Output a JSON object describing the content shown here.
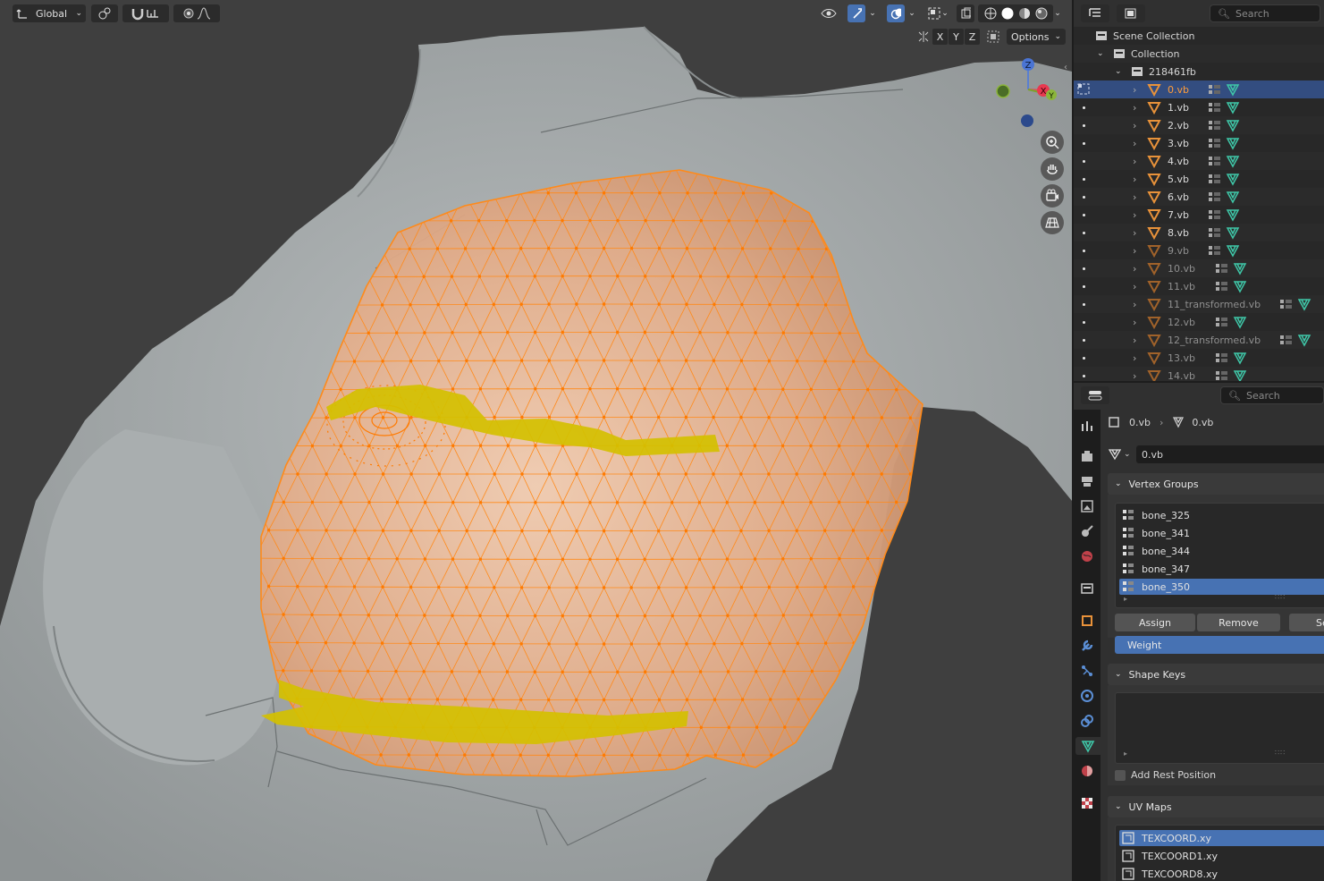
{
  "viewport": {
    "orientation": "Global",
    "options_label": "Options",
    "axes": [
      "X",
      "Y",
      "Z"
    ],
    "gizmo": {
      "z": "Z",
      "x": "X",
      "y": "Y"
    }
  },
  "outliner": {
    "search_placeholder": "Search",
    "scene_collection": "Scene Collection",
    "collection": "Collection",
    "group": "218461fb",
    "items": [
      {
        "label": "0.vb"
      },
      {
        "label": "1.vb"
      },
      {
        "label": "2.vb"
      },
      {
        "label": "3.vb"
      },
      {
        "label": "4.vb"
      },
      {
        "label": "5.vb"
      },
      {
        "label": "6.vb"
      },
      {
        "label": "7.vb"
      },
      {
        "label": "8.vb"
      },
      {
        "label": "9.vb"
      },
      {
        "label": "10.vb"
      },
      {
        "label": "11.vb"
      },
      {
        "label": "11_transformed.vb"
      },
      {
        "label": "12.vb"
      },
      {
        "label": "12_transformed.vb"
      },
      {
        "label": "13.vb"
      },
      {
        "label": "14.vb"
      }
    ]
  },
  "properties": {
    "search_placeholder": "Search",
    "breadcrumb_object": "0.vb",
    "breadcrumb_mesh": "0.vb",
    "mesh_name": "0.vb",
    "vertex_groups": {
      "title": "Vertex Groups",
      "items": [
        "bone_325",
        "bone_341",
        "bone_344",
        "bone_347",
        "bone_350"
      ],
      "assign": "Assign",
      "remove": "Remove",
      "select": "Se",
      "weight": "Weight"
    },
    "shape_keys": {
      "title": "Shape Keys",
      "add_rest_position": "Add Rest Position"
    },
    "uv_maps": {
      "title": "UV Maps",
      "items": [
        "TEXCOORD.xy",
        "TEXCOORD1.xy",
        "TEXCOORD8.xy"
      ]
    }
  },
  "colors": {
    "accent_blue": "#4772b3",
    "selection_orange": "#ff8a1a",
    "weight_yellow": "#d4c000",
    "mesh_teal": "#3fc7a8"
  }
}
